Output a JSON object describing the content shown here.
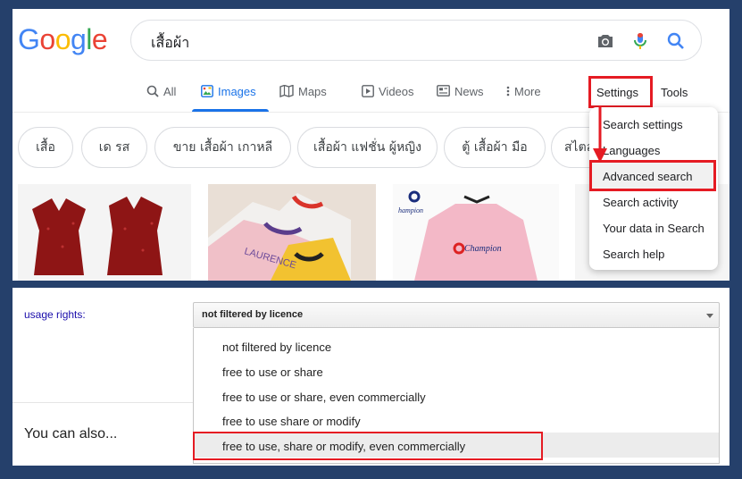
{
  "logo": {
    "text": "Google"
  },
  "search": {
    "query": "เสื้อผ้า"
  },
  "tabs": [
    {
      "label": "All",
      "icon": "search-icon"
    },
    {
      "label": "Images",
      "icon": "image-icon"
    },
    {
      "label": "Maps",
      "icon": "map-icon"
    },
    {
      "label": "Videos",
      "icon": "video-icon"
    },
    {
      "label": "News",
      "icon": "news-icon"
    },
    {
      "label": "More",
      "icon": "more-vert-icon"
    }
  ],
  "settings_label": "Settings",
  "tools_label": "Tools",
  "chips": [
    "เสื้อ",
    "เด รส",
    "ขาย เสื้อผ้า เกาหลี",
    "เสื้อผ้า แฟชั่น ผู้หญิง",
    "ตู้ เสื้อผ้า มือ",
    "สไตล์"
  ],
  "thumbs": {
    "champion_brand": "Champion",
    "laurence_text": "LAURENCE"
  },
  "settings_menu": [
    "Search settings",
    "Languages",
    "Advanced search",
    "Search activity",
    "Your data in Search",
    "Search help"
  ],
  "usage": {
    "label": "usage rights:",
    "selected": "not filtered by licence",
    "options": [
      "not filtered by licence",
      "free to use or share",
      "free to use or share, even commercially",
      "free to use share or modify",
      "free to use, share or modify, even commercially"
    ]
  },
  "you_can_also": "You can also...",
  "colors": {
    "highlight_box": "#e51b23",
    "active_tab": "#1a73e8",
    "background": "#25406b"
  }
}
